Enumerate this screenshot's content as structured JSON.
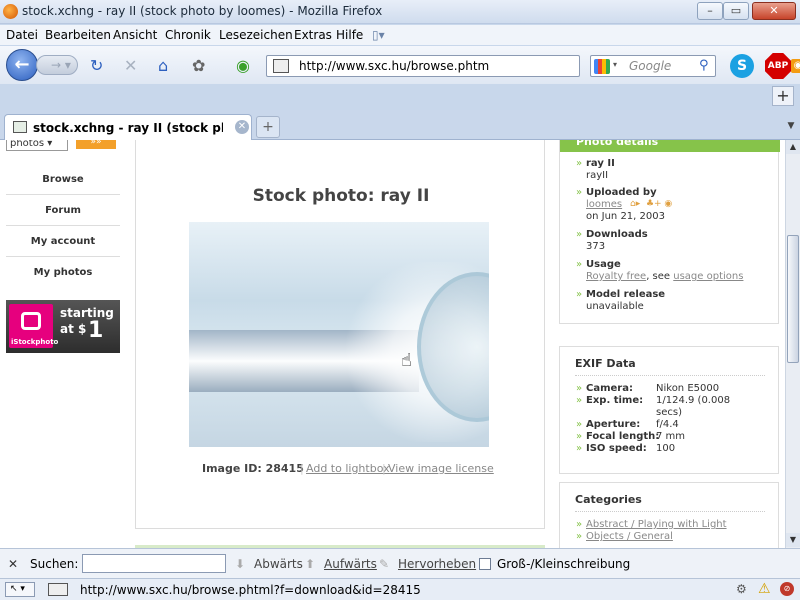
{
  "window": {
    "title": "stock.xchng - ray II (stock photo by loomes) - Mozilla Firefox"
  },
  "menu": [
    "Datei",
    "Bearbeiten",
    "Ansicht",
    "Chronik",
    "Lesezeichen",
    "Extras",
    "Hilfe"
  ],
  "toolbar": {
    "url": "http://www.sxc.hu/browse.phtml?f=view&id=28415",
    "search_placeholder": "Google",
    "abp_label": "ABP"
  },
  "tab": {
    "title": "stock.xchng - ray II (stock photo by l..."
  },
  "left": {
    "search_select": "photos",
    "search_go": "»»",
    "nav": [
      "Browse",
      "Forum",
      "My account",
      "My photos"
    ],
    "ad": {
      "line1": "starting",
      "line2": "at $",
      "price": "1",
      "brand": "iStockphoto"
    }
  },
  "photo": {
    "title": "Stock photo: ray II",
    "image_id": "Image ID: 28415",
    "add_lightbox": "Add to lightbox",
    "view_license": "View image license"
  },
  "details": {
    "header": "Photo details",
    "name_label": "ray II",
    "name_value": "rayII",
    "uploaded_label": "Uploaded by",
    "uploader": "loomes",
    "upload_date": "on Jun 21, 2003",
    "downloads_label": "Downloads",
    "downloads": "373",
    "usage_label": "Usage",
    "usage_link": "Royalty free",
    "usage_sep": ", see ",
    "usage_options": "usage options",
    "model_label": "Model release",
    "model_value": "unavailable"
  },
  "exif": {
    "title": "EXIF Data",
    "rows": [
      {
        "label": "Camera:",
        "value": "Nikon E5000"
      },
      {
        "label": "Exp. time:",
        "value": "1/124.9 (0.008"
      },
      {
        "label": "",
        "value": "secs)"
      },
      {
        "label": "Aperture:",
        "value": "f/4.4"
      },
      {
        "label": "Focal length:",
        "value": "7 mm"
      },
      {
        "label": "ISO speed:",
        "value": "100"
      }
    ]
  },
  "categories": {
    "title": "Categories",
    "items": [
      "Abstract / Playing with Light",
      "Objects / General"
    ]
  },
  "findbar": {
    "label": "Suchen:",
    "down": "Abwärts",
    "up": "Aufwärts",
    "highlight": "Hervorheben",
    "case": "Groß-/Kleinschreibung"
  },
  "status": {
    "url": "http://www.sxc.hu/browse.phtml?f=download&id=28415"
  },
  "colors": {
    "accent_green": "#86c34a",
    "istock_pink": "#e6007e",
    "nav_blue": "#2c5fbf"
  }
}
